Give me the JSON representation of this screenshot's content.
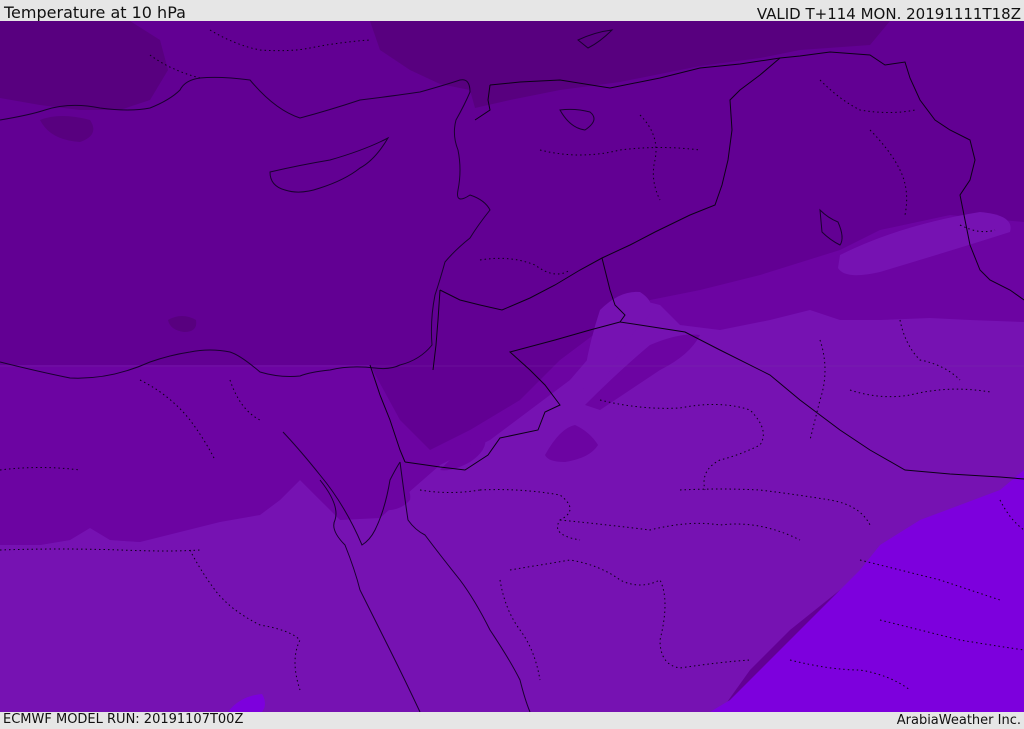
{
  "header": {
    "title": "Temperature at 10 hPa",
    "valid": "VALID T+114 MON. 20191111T18Z"
  },
  "footer": {
    "model_run": "ECMWF MODEL RUN: 20191107T00Z",
    "credit": "ArabiaWeather Inc."
  },
  "map": {
    "shading_colors": {
      "darkest": "#58007f",
      "dark": "#620093",
      "mid": "#6c04a2",
      "light": "#7612b2",
      "brightest": "#7d00dd"
    },
    "line_colors": {
      "coastline": "#1a0030",
      "border": "#0d0018"
    }
  }
}
